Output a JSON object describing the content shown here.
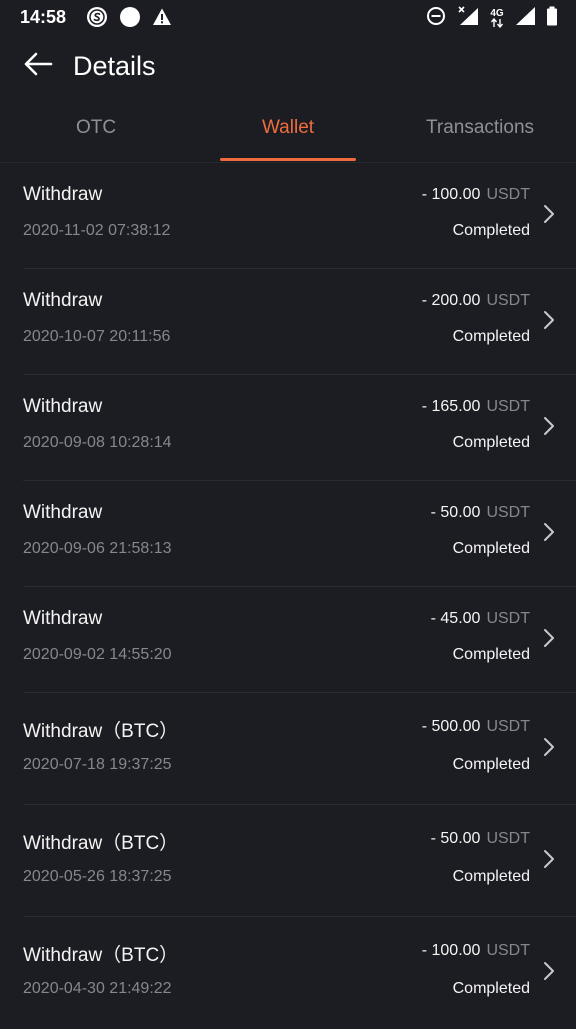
{
  "status_bar": {
    "time": "14:58",
    "network_label": "4G"
  },
  "header": {
    "title": "Details"
  },
  "tabs": [
    {
      "label": "OTC",
      "active": false
    },
    {
      "label": "Wallet",
      "active": true
    },
    {
      "label": "Transactions",
      "active": false
    }
  ],
  "colors": {
    "accent": "#ef6c3e",
    "background": "#1c1d22",
    "muted_text": "#85878d"
  },
  "transactions": [
    {
      "title": "Withdraw",
      "date": "2020-11-02 07:38:12",
      "amount": "- 100.00",
      "unit": "USDT",
      "status": "Completed"
    },
    {
      "title": "Withdraw",
      "date": "2020-10-07 20:11:56",
      "amount": "- 200.00",
      "unit": "USDT",
      "status": "Completed"
    },
    {
      "title": "Withdraw",
      "date": "2020-09-08 10:28:14",
      "amount": "- 165.00",
      "unit": "USDT",
      "status": "Completed"
    },
    {
      "title": "Withdraw",
      "date": "2020-09-06 21:58:13",
      "amount": "- 50.00",
      "unit": "USDT",
      "status": "Completed"
    },
    {
      "title": "Withdraw",
      "date": "2020-09-02 14:55:20",
      "amount": "- 45.00",
      "unit": "USDT",
      "status": "Completed"
    },
    {
      "title": "Withdraw（BTC）",
      "date": "2020-07-18 19:37:25",
      "amount": "- 500.00",
      "unit": "USDT",
      "status": "Completed"
    },
    {
      "title": "Withdraw（BTC）",
      "date": "2020-05-26 18:37:25",
      "amount": "- 50.00",
      "unit": "USDT",
      "status": "Completed"
    },
    {
      "title": "Withdraw（BTC）",
      "date": "2020-04-30 21:49:22",
      "amount": "- 100.00",
      "unit": "USDT",
      "status": "Completed"
    }
  ]
}
